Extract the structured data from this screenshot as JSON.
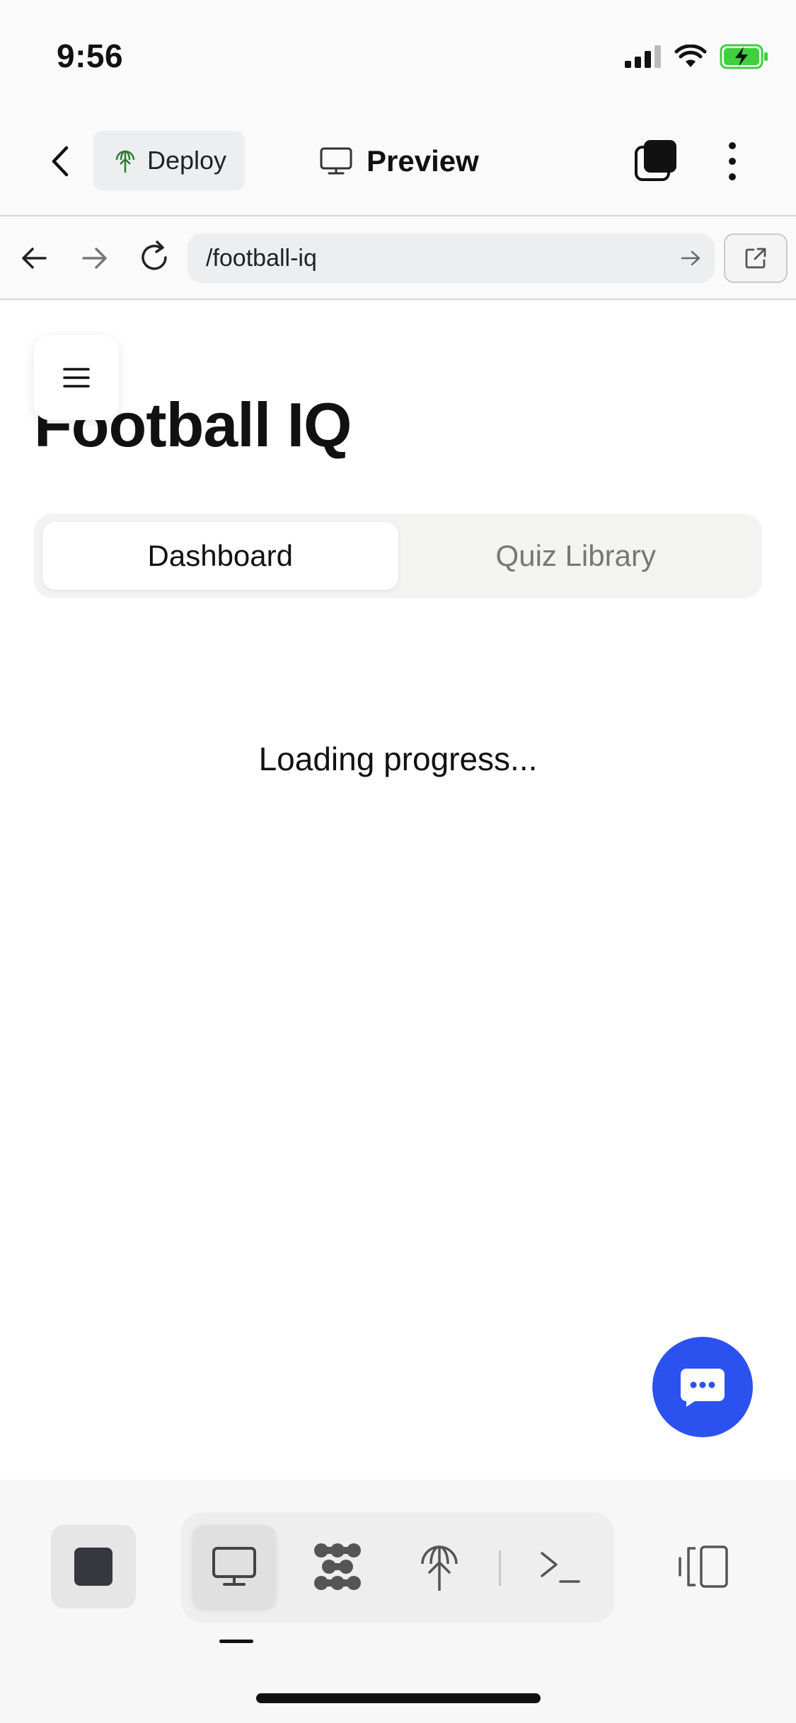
{
  "status_bar": {
    "time": "9:56"
  },
  "header": {
    "deploy_label": "Deploy",
    "title": "Preview"
  },
  "url_bar": {
    "path": "/football-iq"
  },
  "page": {
    "title": "Football IQ",
    "tabs": [
      {
        "label": "Dashboard",
        "active": true
      },
      {
        "label": "Quiz Library",
        "active": false
      }
    ],
    "loading_text": "Loading progress..."
  },
  "bottom_toolbar": {
    "tools": [
      {
        "icon": "monitor-icon",
        "active": true
      },
      {
        "icon": "connections-icon",
        "active": false
      },
      {
        "icon": "deploy-icon",
        "active": false
      },
      {
        "icon": "terminal-icon",
        "active": false
      }
    ]
  },
  "colors": {
    "accent": "#2b52ef",
    "battery": "#3fcf3f",
    "deploy_icon": "#2e7d32"
  }
}
